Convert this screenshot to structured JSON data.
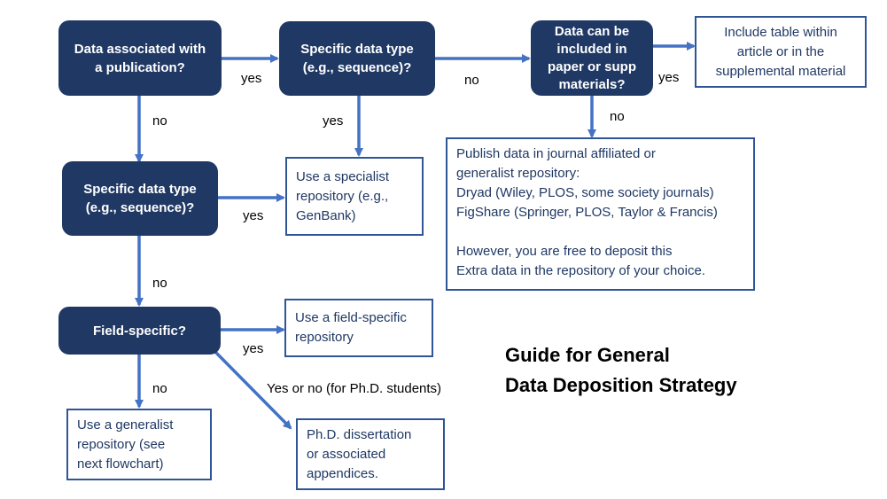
{
  "title": {
    "line1": "Guide for General",
    "line2": "Data Deposition Strategy"
  },
  "colors": {
    "decision_fill": "#1f3864",
    "outcome_border": "#2f5597",
    "arrow": "#4472c4",
    "outcome_text": "#1f3864"
  },
  "decisions": {
    "publication": [
      "Data associated with",
      "a publication?"
    ],
    "specific_top": [
      "Specific data type",
      "(e.g., sequence)?"
    ],
    "included": [
      "Data can be",
      "included in",
      "paper or supp",
      "materials?"
    ],
    "specific_left": [
      "Specific data type",
      "(e.g., sequence)?"
    ],
    "field_specific": [
      "Field-specific?"
    ]
  },
  "outcomes": {
    "include_table": [
      "Include table within",
      "article or in the",
      "supplemental material"
    ],
    "specialist": [
      "Use a specialist",
      "repository (e.g.,",
      "GenBank)"
    ],
    "publish_repo": [
      "Publish data in journal affiliated or",
      "generalist repository:",
      "Dryad (Wiley, PLOS, some society journals)",
      "FigShare (Springer, PLOS, Taylor & Francis)",
      "",
      "However, you are free to deposit this",
      "Extra data in the repository of your choice."
    ],
    "field_repo": [
      "Use a field-specific",
      "repository"
    ],
    "generalist": [
      "Use a generalist",
      "repository (see",
      "next flowchart)"
    ],
    "phd": [
      "Ph.D. dissertation",
      "or associated",
      "appendices."
    ]
  },
  "edge_labels": {
    "pub_yes": "yes",
    "pub_no": "no",
    "spec_top_yes": "yes",
    "spec_top_no": "no",
    "included_yes": "yes",
    "included_no": "no",
    "spec_left_yes": "yes",
    "spec_left_no": "no",
    "field_yes": "yes",
    "field_no": "no",
    "phd_label": "Yes or no (for Ph.D. students)"
  }
}
